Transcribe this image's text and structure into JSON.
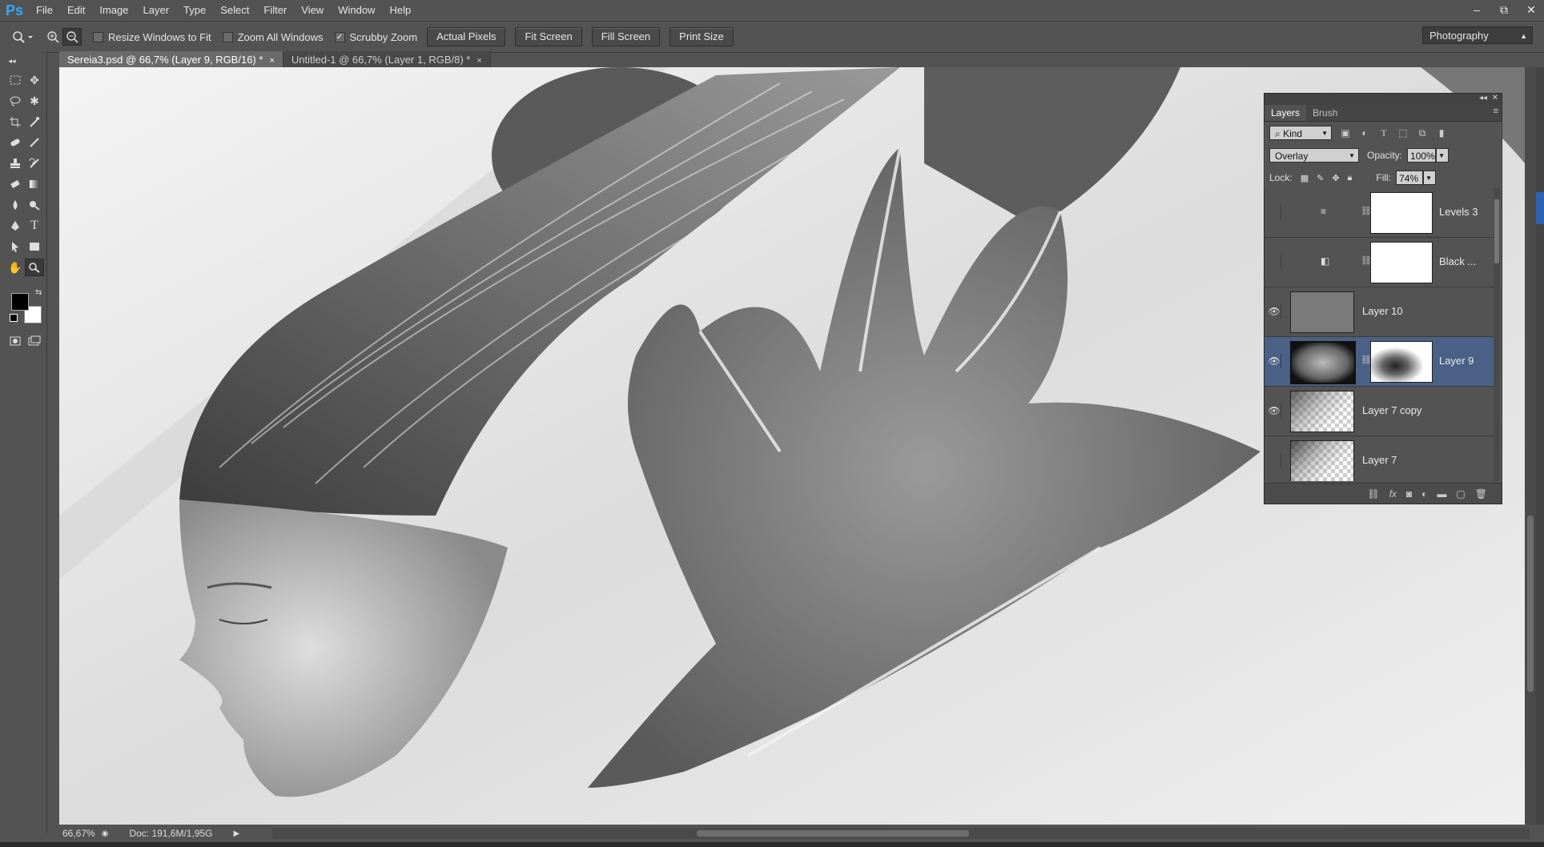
{
  "app": {
    "logo": "Ps"
  },
  "menu": [
    "File",
    "Edit",
    "Image",
    "Layer",
    "Type",
    "Select",
    "Filter",
    "View",
    "Window",
    "Help"
  ],
  "window_controls": {
    "minimize": "–",
    "restore": "⧉",
    "close": "✕"
  },
  "options": {
    "tool_icon": "zoom-icon",
    "resize_windows_label": "Resize Windows to Fit",
    "resize_windows_checked": false,
    "zoom_all_label": "Zoom All Windows",
    "zoom_all_checked": false,
    "scrubby_label": "Scrubby Zoom",
    "scrubby_checked": true,
    "actual_pixels": "Actual Pixels",
    "fit_screen": "Fit Screen",
    "fill_screen": "Fill Screen",
    "print_size": "Print Size",
    "workspace": "Photography"
  },
  "tabs": [
    {
      "label": "Sereia3.psd @ 66,7% (Layer 9, RGB/16) *",
      "close": "×",
      "active": true
    },
    {
      "label": "Untitled-1 @ 66,7% (Layer 1, RGB/8) *",
      "close": "×",
      "active": false
    }
  ],
  "status": {
    "zoom": "66,67%",
    "doc": "Doc: 191,6M/1,95G"
  },
  "layers_panel": {
    "tabs": [
      "Layers",
      "Brush"
    ],
    "filter_kind": "Kind",
    "blend_mode": "Overlay",
    "opacity_label": "Opacity:",
    "opacity_value": "100%",
    "lock_label": "Lock:",
    "fill_label": "Fill:",
    "fill_value": "74%",
    "layers": [
      {
        "name": "Levels 3",
        "visible": false,
        "type": "adjustment",
        "icon": "levels-icon",
        "selected": false
      },
      {
        "name": "Black ...",
        "visible": false,
        "type": "adjustment",
        "icon": "black-white-icon",
        "selected": false
      },
      {
        "name": "Layer 10",
        "visible": true,
        "type": "pixel",
        "selected": false
      },
      {
        "name": "Layer 9",
        "visible": true,
        "type": "masked",
        "selected": true
      },
      {
        "name": "Layer 7 copy",
        "visible": true,
        "type": "pixel",
        "selected": false
      },
      {
        "name": "Layer 7",
        "visible": false,
        "type": "pixel",
        "selected": false
      }
    ]
  },
  "colors": {
    "ui_bg": "#535353",
    "selected_layer": "#4a6185",
    "ps_blue": "#31a8ff"
  }
}
